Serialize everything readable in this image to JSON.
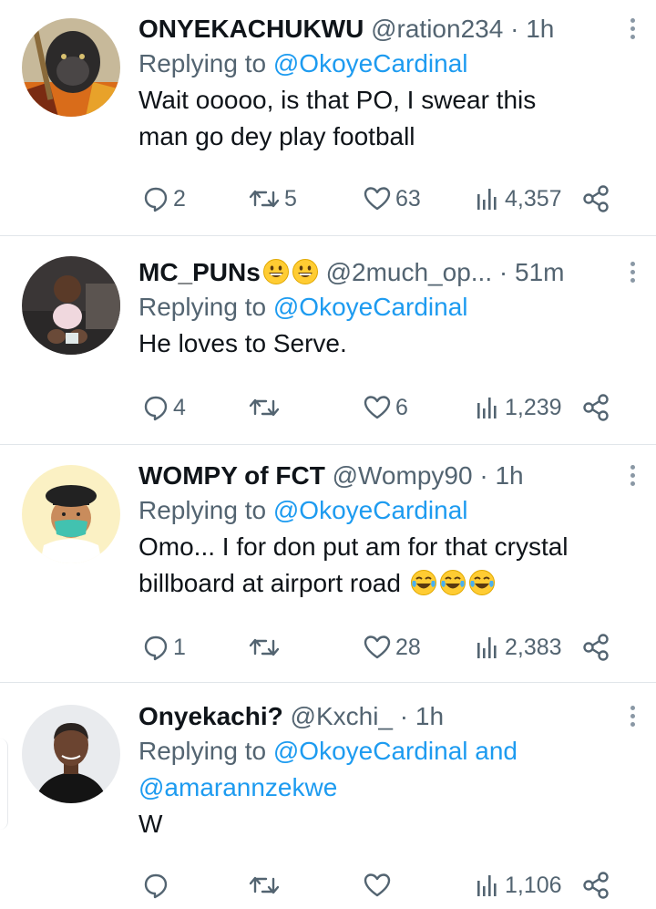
{
  "tweets": [
    {
      "name": "ONYEKACHUKWU",
      "handle": "@ration234",
      "dot": "·",
      "time": "1h",
      "replying_prefix": "Replying to ",
      "replying_to": "@OkoyeCardinal",
      "replying_and": "",
      "replying_to2": "",
      "text_lines": [
        "Wait ooooo, is that PO, I swear this",
        "man go dey play football"
      ],
      "replies": "2",
      "retweets": "5",
      "likes": "63",
      "views": "4,357",
      "avatar_icon": "gorilla-avatar"
    },
    {
      "name": "MC_PUNs",
      "handle": "@2much_op...",
      "dot": "·",
      "time": "51m",
      "replying_prefix": "Replying to ",
      "replying_to": "@OkoyeCardinal",
      "replying_and": "",
      "replying_to2": "",
      "text_lines": [
        "He loves to Serve."
      ],
      "replies": "4",
      "retweets": "",
      "likes": "6",
      "views": "1,239",
      "avatar_icon": "baby-photo-avatar"
    },
    {
      "name": "WOMPY of FCT",
      "handle": "@Wompy90",
      "dot": "·",
      "time": "1h",
      "replying_prefix": "Replying to ",
      "replying_to": "@OkoyeCardinal",
      "replying_and": "",
      "replying_to2": "",
      "text_lines": [
        "Omo... I for don put am for that crystal",
        "billboard at airport road"
      ],
      "replies": "1",
      "retweets": "",
      "likes": "28",
      "views": "2,383",
      "avatar_icon": "cartoon-mask-avatar"
    },
    {
      "name": "Onyekachi?",
      "handle": "@Kxchi_",
      "dot": "·",
      "time": "1h",
      "replying_prefix": "Replying to ",
      "replying_to": "@OkoyeCardinal",
      "replying_and": " and",
      "replying_to2": "@amarannzekwe",
      "text_lines": [
        "W"
      ],
      "replies": "",
      "retweets": "",
      "likes": "",
      "views": "1,106",
      "avatar_icon": "man-portrait-avatar"
    }
  ],
  "colors": {
    "text": "#0f1419",
    "secondary": "#536471",
    "link": "#1d9bf0",
    "divider": "#e1e6ea"
  },
  "icons": {
    "reply": "speech-bubble-icon",
    "retweet": "retweet-arrows-icon",
    "like": "heart-icon",
    "views": "bar-chart-icon",
    "share": "share-nodes-icon",
    "more": "vertical-ellipsis-icon",
    "emoji_grin": "grinning-face-emoji",
    "emoji_laugh": "tears-of-joy-emoji"
  }
}
